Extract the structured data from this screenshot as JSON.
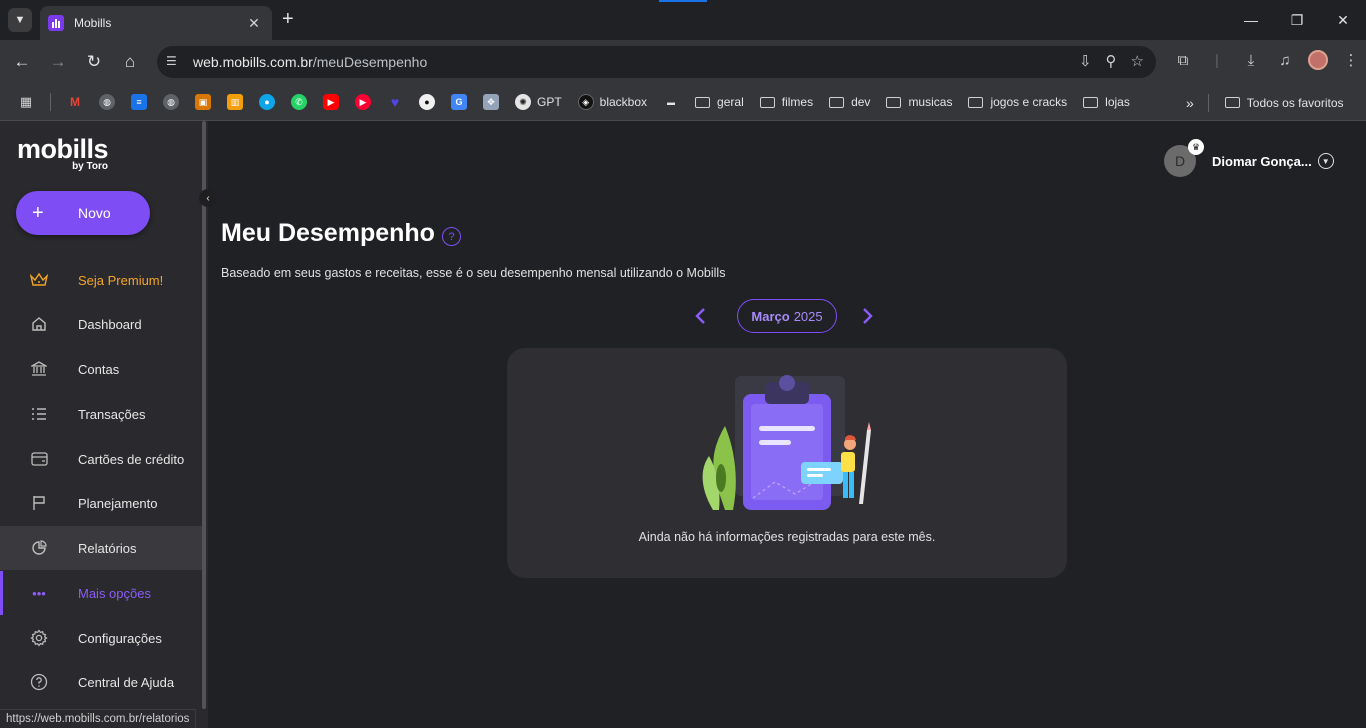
{
  "browser": {
    "tab_title": "Mobills",
    "url_host": "web.mobills.com.br",
    "url_path": "/meuDesempenho",
    "status_url": "https://web.mobills.com.br/relatorios",
    "bookmarks": [
      {
        "label": "",
        "icon": "apps-grid-icon"
      },
      {
        "label": "",
        "icon": "gmail-icon",
        "color": "#ea4335"
      },
      {
        "label": "",
        "icon": "globe-icon",
        "color": "#5f6368"
      },
      {
        "label": "",
        "icon": "bookmark-blue-icon",
        "color": "#1a73e8"
      },
      {
        "label": "",
        "icon": "globe-icon",
        "color": "#5f6368"
      },
      {
        "label": "",
        "icon": "presentation-icon",
        "color": "#d97706"
      },
      {
        "label": "",
        "icon": "shop-icon",
        "color": "#f59e0b"
      },
      {
        "label": "",
        "icon": "chat-icon",
        "color": "#0ea5e9"
      },
      {
        "label": "",
        "icon": "whatsapp-icon",
        "color": "#25d366"
      },
      {
        "label": "",
        "icon": "youtube-icon",
        "color": "#ff0000"
      },
      {
        "label": "",
        "icon": "youtube-music-icon",
        "color": "#ff0033"
      },
      {
        "label": "",
        "icon": "heart-icon",
        "color": "#4338ca"
      },
      {
        "label": "",
        "icon": "github-icon",
        "color": "#f0f0f0"
      },
      {
        "label": "",
        "icon": "translate-icon",
        "color": "#4285f4"
      },
      {
        "label": "",
        "icon": "map-icon",
        "color": "#64748b"
      },
      {
        "label": "GPT",
        "icon": "openai-icon",
        "color": "#e5e5e5"
      },
      {
        "label": "blackbox",
        "icon": "blackbox-icon",
        "color": "#111111"
      },
      {
        "label": "",
        "icon": "amazon-icon",
        "color": "#e5e5e5"
      }
    ],
    "folders": [
      "geral",
      "filmes",
      "dev",
      "musicas",
      "jogos e cracks",
      "lojas"
    ],
    "all_bookmarks_label": "Todos os favoritos"
  },
  "sidebar": {
    "logo": "mobills",
    "logo_sub": "by Toro",
    "new_button": "Novo",
    "items": [
      {
        "label": "Seja Premium!",
        "icon": "crown-icon"
      },
      {
        "label": "Dashboard",
        "icon": "home-icon"
      },
      {
        "label": "Contas",
        "icon": "bank-icon"
      },
      {
        "label": "Transações",
        "icon": "list-icon"
      },
      {
        "label": "Cartões de crédito",
        "icon": "credit-card-icon"
      },
      {
        "label": "Planejamento",
        "icon": "flag-icon"
      },
      {
        "label": "Relatórios",
        "icon": "pie-chart-icon"
      },
      {
        "label": "Mais opções",
        "icon": "more-dots-icon"
      },
      {
        "label": "Configurações",
        "icon": "gear-icon"
      },
      {
        "label": "Central de Ajuda",
        "icon": "help-circle-icon"
      }
    ]
  },
  "user": {
    "initial": "D",
    "name": "Diomar Gonça..."
  },
  "main": {
    "title": "Meu Desempenho",
    "subtitle": "Baseado em seus gastos e receitas, esse é o seu desempenho mensal utilizando o Mobills",
    "month": "Março",
    "year": "2025",
    "empty_message": "Ainda não há informações registradas para este mês."
  },
  "colors": {
    "accent": "#7e4ef4",
    "premium": "#f5a524",
    "sidebar_bg": "#2a2a2e",
    "card_bg": "#2f2f33"
  }
}
